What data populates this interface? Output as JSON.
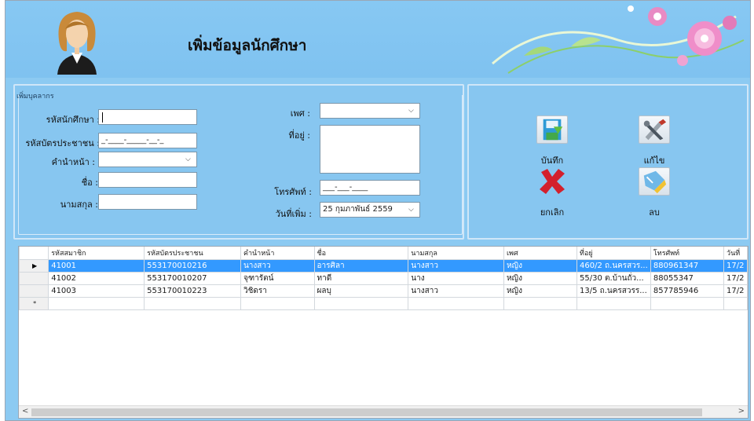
{
  "header": {
    "title": "เพิ่มข้อมูลนักศึกษา"
  },
  "form": {
    "group_title": "เพิ่มบุคลากร",
    "student_id": {
      "label": "รหัสนักศึกษา :",
      "value": ""
    },
    "national_id": {
      "label": "รหัสบัตรประชาชน :",
      "value": "_-____-_____-__-_"
    },
    "prefix": {
      "label": "คำนำหน้า :",
      "value": ""
    },
    "first_name": {
      "label": "ชื่อ :",
      "value": ""
    },
    "last_name": {
      "label": "นามสกุล :",
      "value": ""
    },
    "gender": {
      "label": "เพศ :",
      "value": ""
    },
    "address": {
      "label": "ที่อยู่ :",
      "value": ""
    },
    "phone": {
      "label": "โทรศัพท์ :",
      "value": "___-___-____"
    },
    "date_added": {
      "label": "วันที่เพิ่ม :",
      "value": "25  กุมภาพันธ์   2559"
    }
  },
  "actions": {
    "save": "บันทึก",
    "edit": "แก้ไข",
    "cancel": "ยกเลิก",
    "delete": "ลบ"
  },
  "grid": {
    "columns": [
      "รหัสสมาชิก",
      "รหัสบัตรประชาชน",
      "คำนำหน้า",
      "ชื่อ",
      "นามสกุล",
      "เพศ",
      "ที่อยู่",
      "โทรศัพท์",
      "วันที่"
    ],
    "rows": [
      {
        "marker": "▶",
        "cells": [
          "41001",
          "553170010216",
          "นางสาว",
          "อารศิลา",
          "นางสาว",
          "หญิง",
          "460/2 ถ.นครสวร...",
          "880961347",
          "17/2"
        ]
      },
      {
        "marker": "",
        "cells": [
          "41002",
          "553170010207",
          "จุฑารัตน์",
          "ทาดี",
          "นาง",
          "หญิง",
          "55/30 ต.บ้านถั่ว...",
          "88055347",
          "17/2"
        ]
      },
      {
        "marker": "",
        "cells": [
          "41003",
          "553170010223",
          "วิชิดรา",
          "ผลบุ",
          "นางสาว",
          "หญิง",
          "13/5 ถ.นครสวรร...",
          "857785946",
          "17/2"
        ]
      },
      {
        "marker": "*",
        "cells": [
          "",
          "",
          "",
          "",
          "",
          "",
          "",
          "",
          ""
        ]
      }
    ],
    "scroll_left": "<",
    "scroll_right": ">"
  },
  "colors": {
    "window_bg": "#8ccaf2",
    "selection": "#3399ff"
  },
  "icons": [
    "person-avatar-icon",
    "save-disk-icon",
    "tools-icon",
    "cancel-x-icon",
    "eraser-delete-icon"
  ]
}
